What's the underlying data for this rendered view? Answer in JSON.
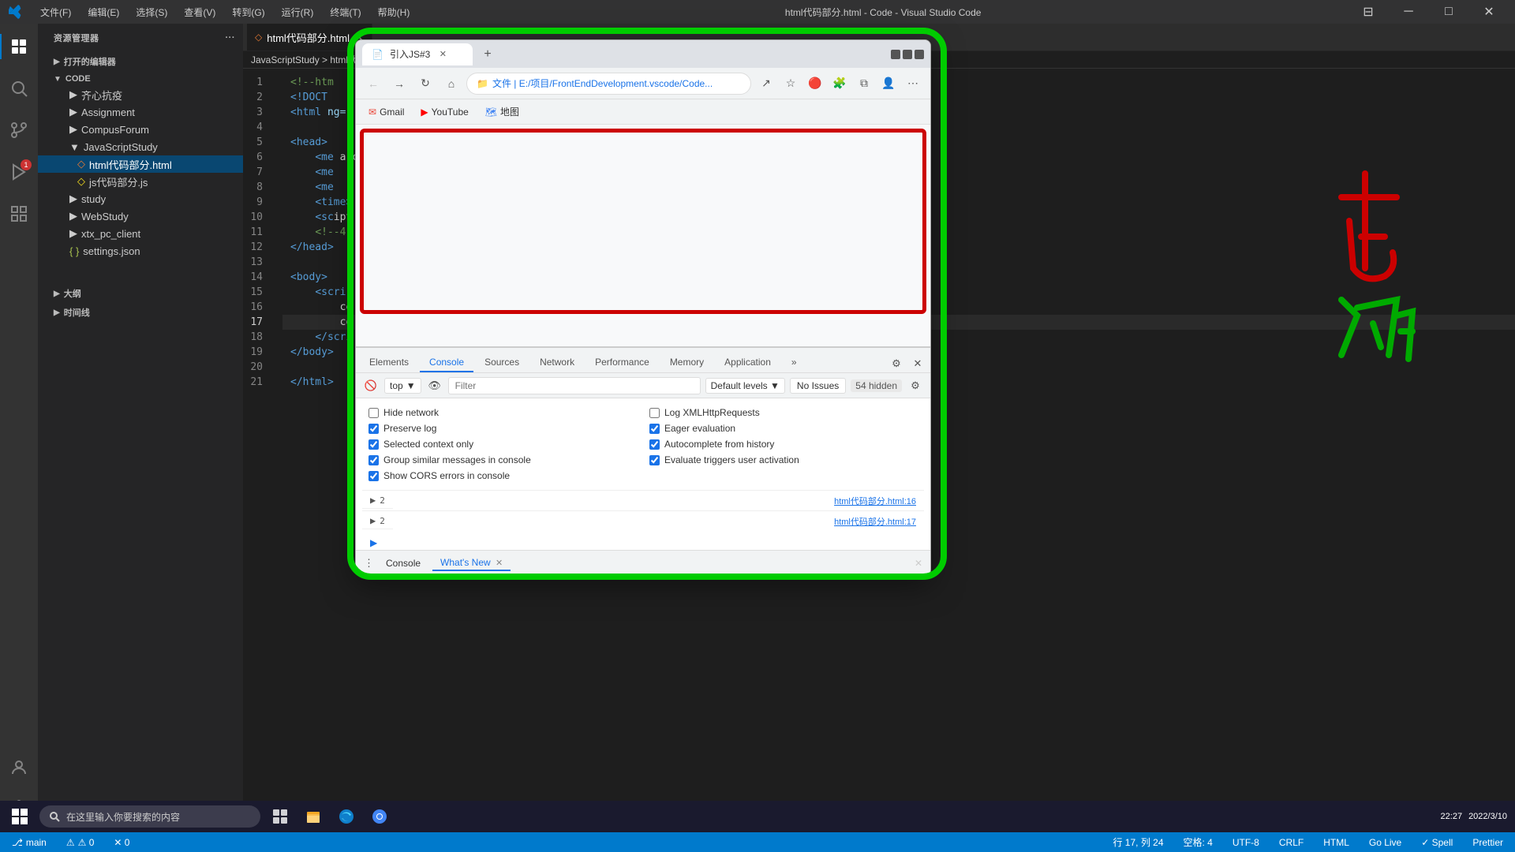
{
  "titlebar": {
    "title": "html代码部分.html - Code - Visual Studio Code",
    "menu": [
      "文件(F)",
      "编辑(E)",
      "选择(S)",
      "查看(V)",
      "转到(G)",
      "运行(R)",
      "终端(T)",
      "帮助(H)"
    ]
  },
  "sidebar": {
    "header": "资源管理器",
    "open_editors": "打开的编辑器",
    "root": "CODE",
    "items": [
      {
        "label": "齐心抗疫",
        "type": "folder",
        "indent": 1
      },
      {
        "label": "Assignment",
        "type": "folder",
        "indent": 1
      },
      {
        "label": "CompusForum",
        "type": "folder",
        "indent": 1
      },
      {
        "label": "JavaScriptStudy",
        "type": "folder",
        "indent": 1,
        "open": true
      },
      {
        "label": "html代码部分.html",
        "type": "file-html",
        "indent": 2,
        "active": true
      },
      {
        "label": "js代码部分.js",
        "type": "file-js",
        "indent": 2
      },
      {
        "label": "study",
        "type": "folder",
        "indent": 1
      },
      {
        "label": "WebStudy",
        "type": "folder",
        "indent": 1
      },
      {
        "label": "xtx_pc_client",
        "type": "folder",
        "indent": 1
      },
      {
        "label": "settings.json",
        "type": "file-json",
        "indent": 1
      }
    ],
    "bottom_sections": [
      {
        "label": "大纲",
        "indent": 0
      },
      {
        "label": "时间线",
        "indent": 0
      }
    ]
  },
  "editor": {
    "tab_label": "html代码部分.html",
    "breadcrumb": "JavaScriptStudy > html代码部分.html",
    "lines": [
      {
        "num": 1,
        "code": "<!--htm"
      },
      {
        "num": 2,
        "code": "<!DOCT"
      },
      {
        "num": 3,
        "code": "<html  ng="
      },
      {
        "num": 4,
        "code": ""
      },
      {
        "num": 5,
        "code": "<head>"
      },
      {
        "num": 6,
        "code": "    <me a c"
      },
      {
        "num": 7,
        "code": "    <me     h"
      },
      {
        "num": 8,
        "code": "    <me     n"
      },
      {
        "num": 9,
        "code": "    <time>"
      },
      {
        "num": 10,
        "code": "    <sc ipt"
      },
      {
        "num": 11,
        "code": "    <!--4"
      },
      {
        "num": 12,
        "code": "</head>"
      },
      {
        "num": 13,
        "code": ""
      },
      {
        "num": 14,
        "code": "<body>"
      },
      {
        "num": 15,
        "code": "    <scri"
      },
      {
        "num": 16,
        "code": "        co"
      },
      {
        "num": 17,
        "code": "        co",
        "active": true
      },
      {
        "num": 18,
        "code": "    </scri"
      },
      {
        "num": 19,
        "code": "</body>"
      },
      {
        "num": 20,
        "code": ""
      },
      {
        "num": 21,
        "code": "</html>"
      }
    ]
  },
  "browser": {
    "tab_title": "引入JS#3",
    "address": "文件 | E:/项目/FrontEndDevelopment.vscode/Code...",
    "bookmarks": [
      {
        "label": "Gmail",
        "icon": "gmail"
      },
      {
        "label": "YouTube",
        "icon": "youtube"
      },
      {
        "label": "地图",
        "icon": "map"
      }
    ]
  },
  "devtools": {
    "tabs": [
      "Elements",
      "Console",
      "Sources",
      "Performance",
      "Memory",
      "Application"
    ],
    "active_tab": "Console",
    "context": "top",
    "filter_placeholder": "Filter",
    "level": "Default levels",
    "issues": "No Issues",
    "hidden": "54 hidden",
    "checkboxes": [
      {
        "label": "Hide network",
        "checked": false,
        "col": 1
      },
      {
        "label": "Log XMLHttpRequests",
        "checked": false,
        "col": 2
      },
      {
        "label": "Preserve log",
        "checked": true,
        "col": 1
      },
      {
        "label": "Eager evaluation",
        "checked": true,
        "col": 2
      },
      {
        "label": "Selected context only",
        "checked": true,
        "col": 1
      },
      {
        "label": "Autocomplete from history",
        "checked": true,
        "col": 2
      },
      {
        "label": "Group similar messages in console",
        "checked": true,
        "col": 1
      },
      {
        "label": "Evaluate triggers user activation",
        "checked": true,
        "col": 2
      },
      {
        "label": "Show CORS errors in console",
        "checked": true,
        "col": 1
      }
    ],
    "source_links": [
      "html代码部分.html:16",
      "html代码部分.html:17"
    ],
    "footer_tabs": [
      "Console",
      "What's New"
    ]
  },
  "statusbar": {
    "left": [
      "⚠ 0",
      "✕ 0"
    ],
    "right": [
      "行 17, 列 24",
      "空格: 4",
      "UTF-8",
      "CRLF",
      "HTML",
      "Go Live",
      "✓ Spell",
      "Prettier"
    ]
  },
  "taskbar": {
    "search_placeholder": "在这里输入你要搜索的内容",
    "time": "22:27",
    "date": "2022/3/10"
  },
  "annotations": {
    "red_border_color": "#cc0000",
    "green_border_color": "#00cc00"
  }
}
